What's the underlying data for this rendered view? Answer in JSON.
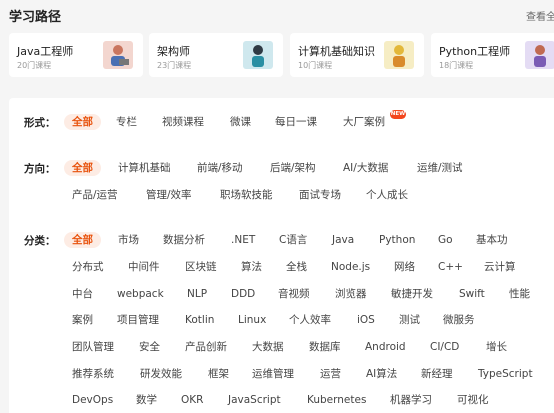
{
  "header": {
    "title": "学习路径",
    "view_all": "查看全部"
  },
  "cards": [
    {
      "title": "Java工程师",
      "sub": "20门课程",
      "thumb_color": "#f3d6cf"
    },
    {
      "title": "架构师",
      "sub": "23门课程",
      "thumb_color": "#cfe8ee"
    },
    {
      "title": "计算机基础知识",
      "sub": "10门课程",
      "thumb_color": "#f6edc4"
    },
    {
      "title": "Python工程师",
      "sub": "18门课程",
      "thumb_color": "#e4dcf4"
    }
  ],
  "filters": {
    "form": {
      "label": "形式：",
      "tags": [
        "全部",
        "专栏",
        "视频课程",
        "微课",
        "每日一课",
        "大厂案例"
      ],
      "new_badge": "NEW"
    },
    "direction": {
      "label": "方向：",
      "tags": [
        "全部",
        "计算机基础",
        "前端/移动",
        "后端/架构",
        "AI/大数据",
        "运维/测试",
        "产品/运营",
        "管理/效率",
        "职场软技能",
        "面试专场",
        "个人成长"
      ]
    },
    "category": {
      "label": "分类：",
      "tags": [
        "全部",
        "市场",
        "数据分析",
        ".NET",
        "C语言",
        "Java",
        "Python",
        "Go",
        "基本功",
        "分布式",
        "中间件",
        "区块链",
        "算法",
        "全栈",
        "Node.js",
        "网络",
        "C++",
        "云计算",
        "中台",
        "webpack",
        "NLP",
        "DDD",
        "音视频",
        "浏览器",
        "敏捷开发",
        "Swift",
        "性能",
        "案例",
        "项目管理",
        "Kotlin",
        "Linux",
        "个人效率",
        "iOS",
        "测试",
        "微服务",
        "团队管理",
        "安全",
        "产品创新",
        "大数据",
        "数据库",
        "Android",
        "CI/CD",
        "增长",
        "推荐系统",
        "研发效能",
        "框架",
        "运维管理",
        "运营",
        "AI算法",
        "新经理",
        "TypeScript",
        "DevOps",
        "数学",
        "OKR",
        "JavaScript",
        "Kubernetes",
        "机器学习",
        "可视化"
      ]
    }
  },
  "colors": {
    "accent": "#e8530e",
    "accent_bg": "#fdece4"
  }
}
